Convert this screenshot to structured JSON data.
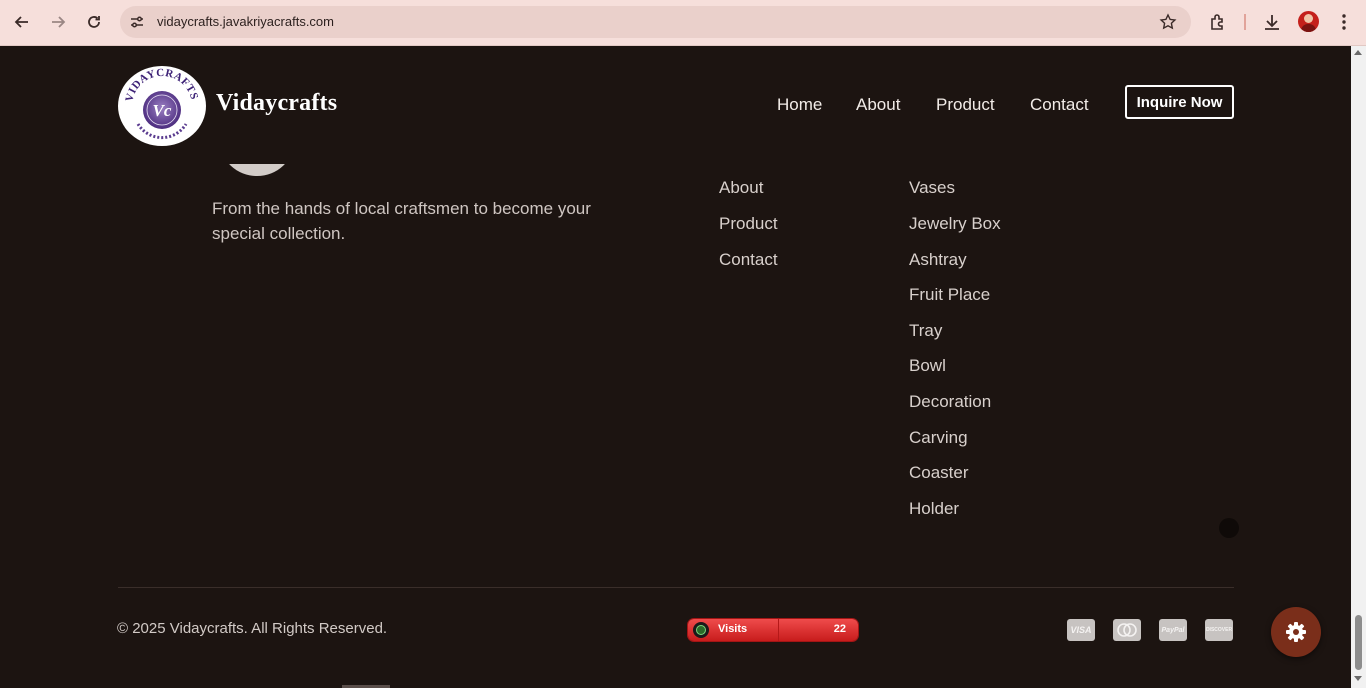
{
  "browser": {
    "url": "vidaycrafts.javakriyacrafts.com",
    "icons": [
      "back-icon",
      "forward-icon",
      "reload-icon",
      "site-settings-icon",
      "bookmark-star-icon",
      "extensions-icon",
      "download-icon",
      "profile-avatar",
      "more-menu-icon"
    ]
  },
  "header": {
    "brand": "Vidaycrafts",
    "logo_text": "VIDAYCRAFTS",
    "logo_monogram": "Vc",
    "nav": [
      "Home",
      "About",
      "Product",
      "Contact"
    ],
    "cta": "Inquire Now"
  },
  "footer": {
    "tagline": "From the hands of local craftsmen to become your special collection.",
    "links": [
      "About",
      "Product",
      "Contact"
    ],
    "products": [
      "Vases",
      "Jewelry Box",
      "Ashtray",
      "Fruit Place",
      "Tray",
      "Bowl",
      "Decoration",
      "Carving",
      "Coaster",
      "Holder"
    ],
    "copyright": "© 2025 Vidaycrafts. All Rights Reserved.",
    "visits_label": "Visits",
    "visits_count": "22",
    "payment_cards": [
      "VISA",
      "MC",
      "PayPal",
      "DISCOVER"
    ]
  },
  "colors": {
    "page_bg": "#1c1411",
    "browser_bar": "#f6dfdb",
    "accent_fab": "#7a2e1a",
    "visits_badge": "#d42a2a"
  }
}
